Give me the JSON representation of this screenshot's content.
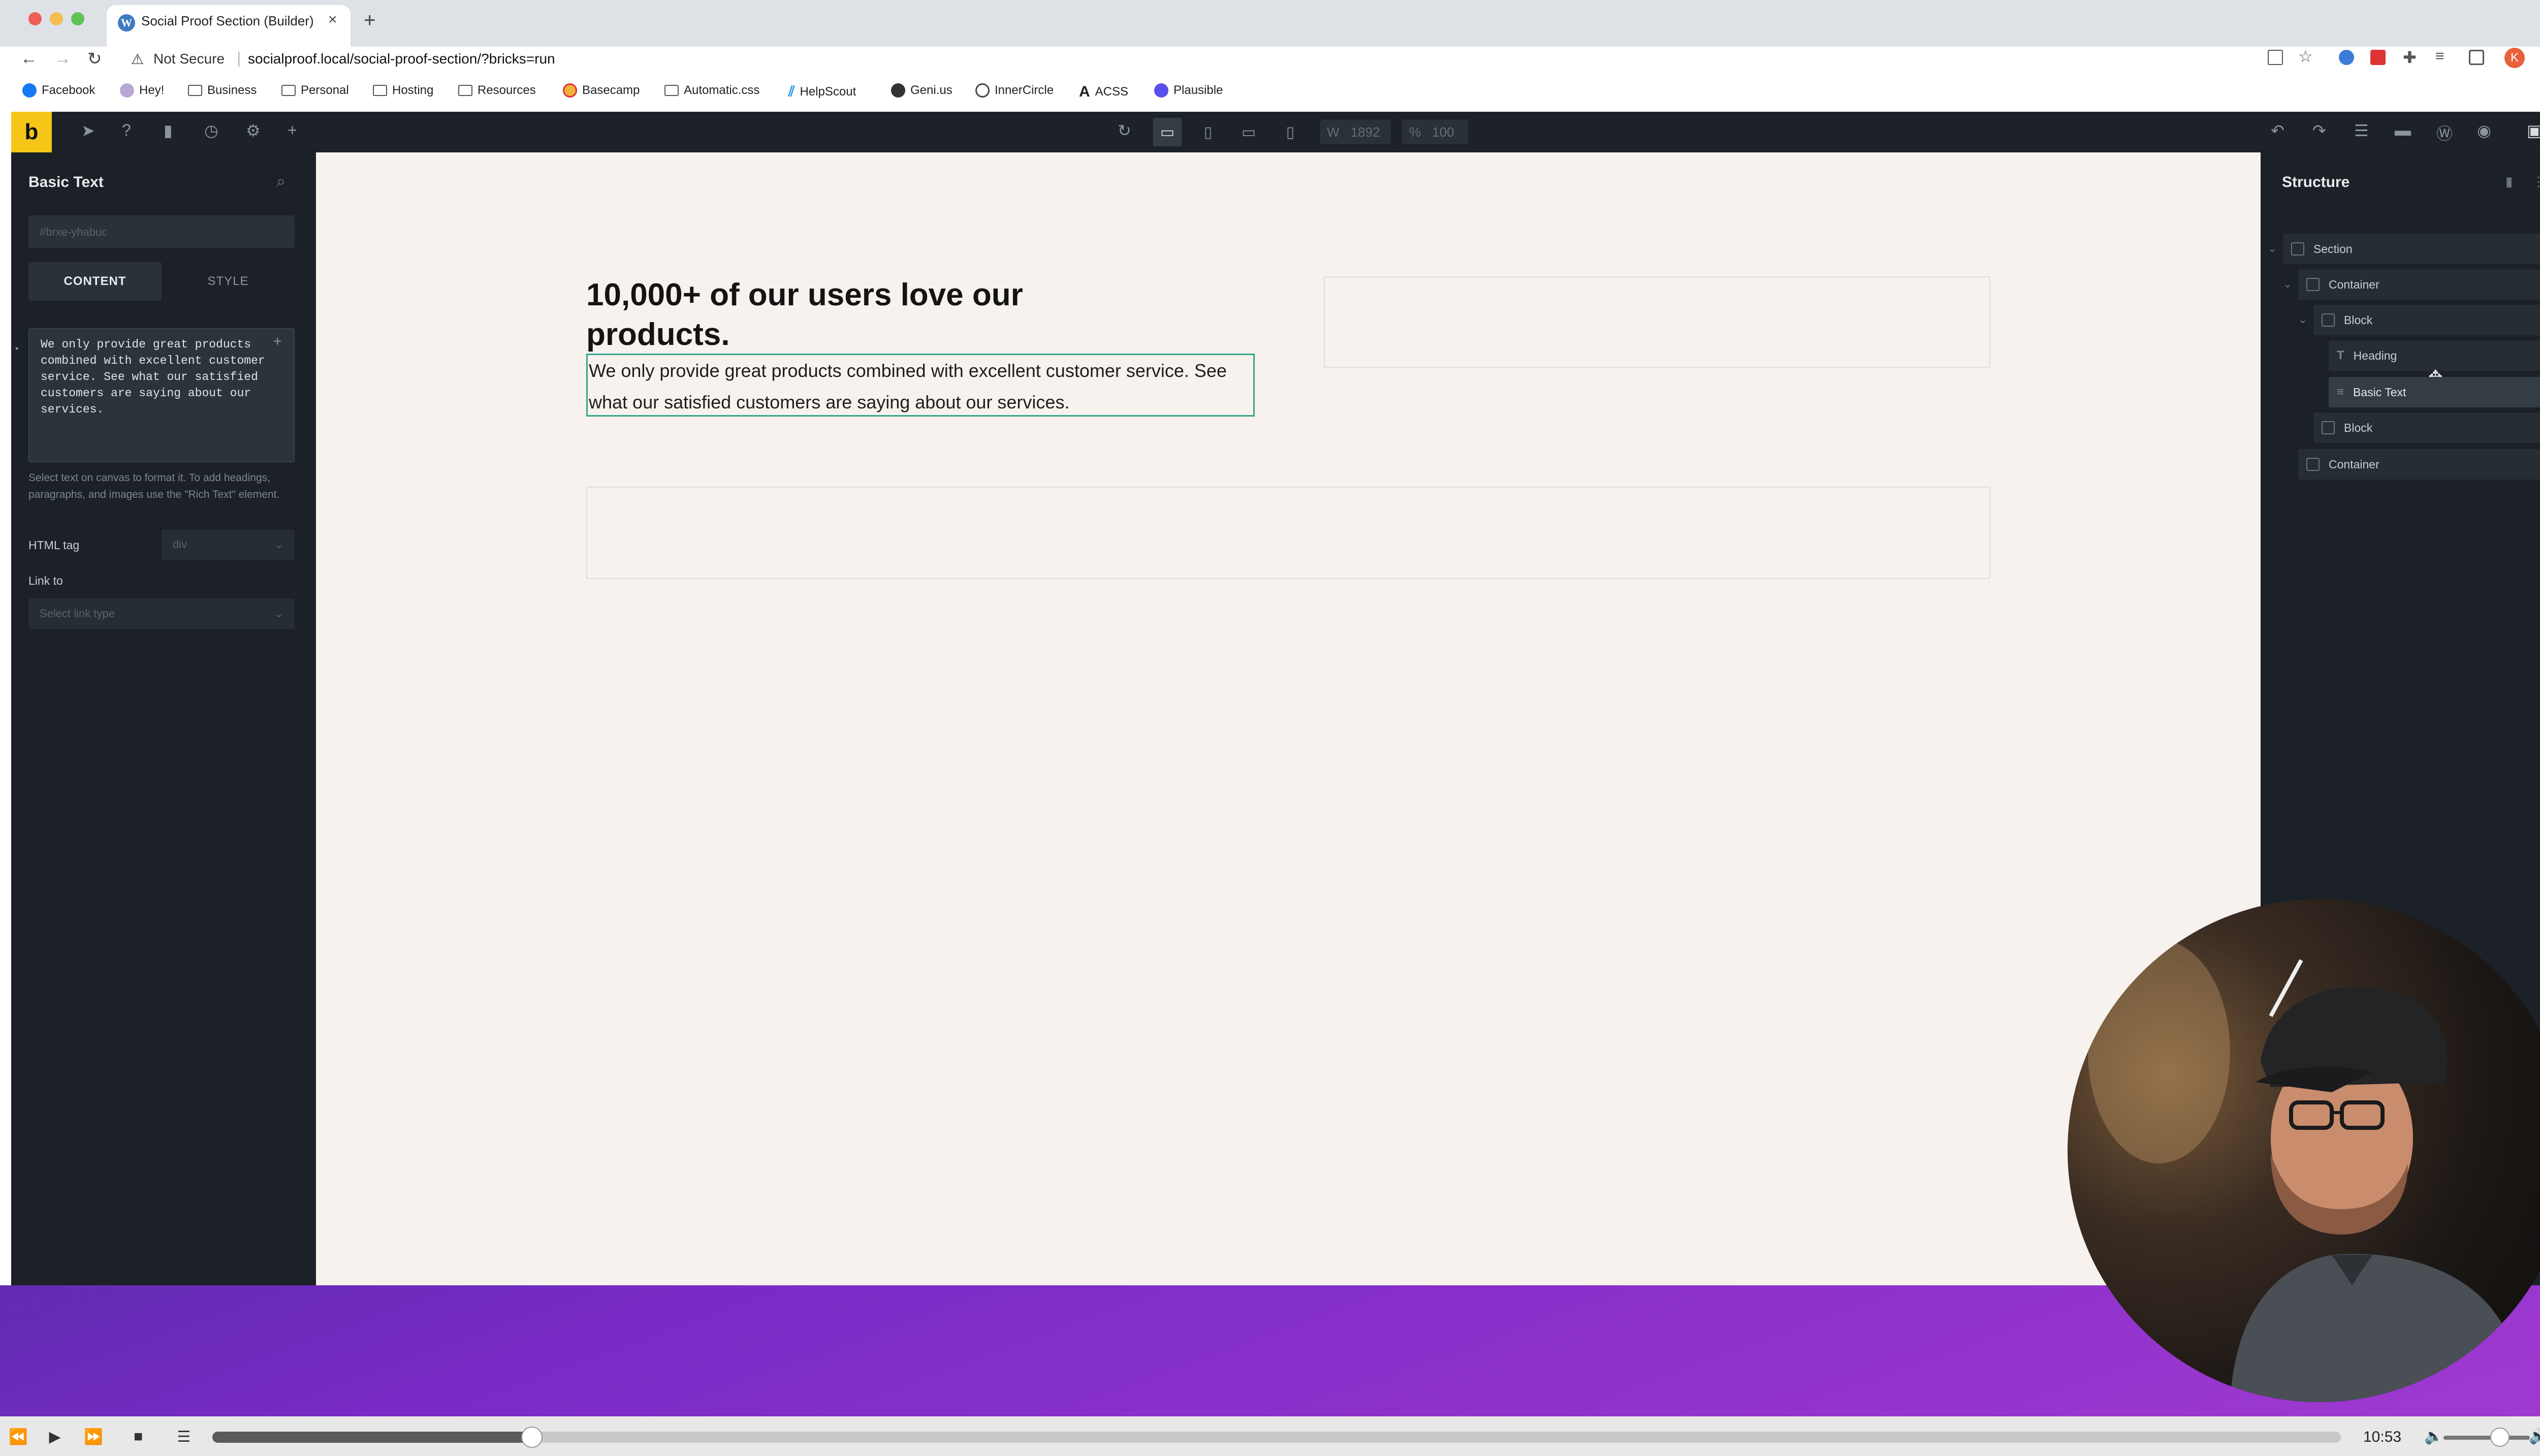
{
  "browser": {
    "tab_title": "Social Proof Section (Builder)",
    "tab_favicon": "wordpress-icon",
    "security_label": "Not Secure",
    "url": "socialproof.local/social-proof-section/?bricks=run",
    "bookmarks": [
      {
        "label": "Facebook",
        "icon": "facebook-icon"
      },
      {
        "label": "Hey!",
        "icon": "hey-icon"
      },
      {
        "label": "Business",
        "icon": "folder-icon"
      },
      {
        "label": "Personal",
        "icon": "folder-icon"
      },
      {
        "label": "Hosting",
        "icon": "folder-icon"
      },
      {
        "label": "Resources",
        "icon": "folder-icon"
      },
      {
        "label": "Basecamp",
        "icon": "basecamp-icon"
      },
      {
        "label": "Automatic.css",
        "icon": "folder-icon"
      },
      {
        "label": "HelpScout",
        "icon": "helpscout-icon"
      },
      {
        "label": "Geni.us",
        "icon": "geni-icon"
      },
      {
        "label": "InnerCircle",
        "icon": "circle-icon"
      },
      {
        "label": "ACSS",
        "icon": "acss-icon"
      },
      {
        "label": "Plausible",
        "icon": "plausible-icon"
      }
    ],
    "profile_initial": "K"
  },
  "toolbar": {
    "logo": "b",
    "width_label": "W",
    "width_value": "1892",
    "zoom_label": "%",
    "zoom_value": "100"
  },
  "left_panel": {
    "title": "Basic Text",
    "element_id": "#brxe-yhabuc",
    "tab_content": "CONTENT",
    "tab_style": "STYLE",
    "text_value": "We only provide great products combined with excellent customer service. See what our satisfied customers are saying about our services.",
    "help_text": "Select text on canvas to format it. To add headings, paragraphs, and images use the \"Rich Text\" element.",
    "html_tag_label": "HTML tag",
    "html_tag_value": "div",
    "link_label": "Link to",
    "link_placeholder": "Select link type"
  },
  "canvas": {
    "heading": "10,000+ of our users love our products.",
    "text": "We only provide great products combined with excellent customer service. See what our satisfied customers are saying about our services."
  },
  "structure": {
    "title": "Structure",
    "items": [
      {
        "label": "Section",
        "depth": 0,
        "type": "section"
      },
      {
        "label": "Container",
        "depth": 1,
        "type": "container"
      },
      {
        "label": "Block",
        "depth": 2,
        "type": "block"
      },
      {
        "label": "Heading",
        "depth": 3,
        "type": "heading"
      },
      {
        "label": "Basic Text",
        "depth": 3,
        "type": "text",
        "selected": true
      },
      {
        "label": "Block",
        "depth": 2,
        "type": "block"
      },
      {
        "label": "Container",
        "depth": 1,
        "type": "container"
      }
    ]
  },
  "player": {
    "time": "10:53",
    "progress_fraction": 0.15
  },
  "colors": {
    "accent_yellow": "#f5c518",
    "selection_green": "#3aa58c",
    "panel_bg": "#1b2126",
    "canvas_bg": "#f8f2ef"
  }
}
